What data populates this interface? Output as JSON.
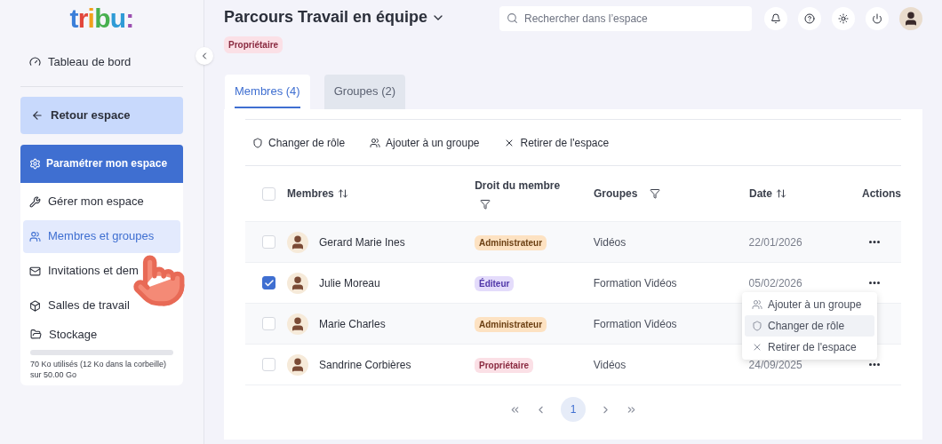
{
  "logo": "tribu:",
  "sidebar": {
    "dashboard": {
      "label": "Tableau de bord"
    },
    "back_button": {
      "label": "Retour espace"
    },
    "settings_button": {
      "label": "Paramétrer mon espace",
      "selected": true
    },
    "items": [
      {
        "kind": "wrench",
        "label": "Gérer mon espace",
        "selected": false
      },
      {
        "kind": "users",
        "label": "Membres et groupes",
        "selected": true
      },
      {
        "kind": "mail",
        "label": "Invitations et dem",
        "selected": false
      },
      {
        "kind": "box",
        "label": "Salles de travail",
        "selected": false
      }
    ],
    "storage": {
      "label": "Stockage",
      "level": 0,
      "usage": "70 Ko utilisés (12 Ko dans la corbeille) sur 50.00 Go"
    }
  },
  "header": {
    "title": "Parcours Travail en équipe",
    "role_badge": "Propriétaire",
    "search": {
      "placeholder": "Rechercher dans l’espace"
    }
  },
  "tabs": [
    {
      "label": "Membres (4)",
      "selected": true
    },
    {
      "label": "Groupes (2)",
      "selected": false
    }
  ],
  "toolbar": [
    {
      "kind": "shield",
      "label": "Changer de rôle"
    },
    {
      "kind": "users",
      "label": "Ajouter à un groupe"
    },
    {
      "kind": "x",
      "label": "Retirer de l'espace"
    }
  ],
  "table": {
    "columns": [
      {
        "label": "Membres",
        "kind": "sort"
      },
      {
        "label": "Droit du membre",
        "kind": "filter"
      },
      {
        "label": "Groupes",
        "kind": "filter"
      },
      {
        "label": "Date",
        "kind": "sort"
      },
      {
        "label": "Actions",
        "kind": "plain"
      }
    ],
    "header_checked": false,
    "rows": [
      {
        "name": "Gerard Marie Ines",
        "role": "Administrateur",
        "kind": "admin",
        "groups": "Vidéos",
        "date": "22/01/2026",
        "checked": false,
        "menu_open": false
      },
      {
        "name": "Julie Moreau",
        "role": "Éditeur",
        "kind": "editor",
        "groups": "Formation Vidéos",
        "date": "05/02/2026",
        "checked": true,
        "menu_open": true
      },
      {
        "name": "Marie Charles",
        "role": "Administrateur",
        "kind": "admin",
        "groups": "Formation Vidéos",
        "checked": false,
        "menu_open": false
      },
      {
        "name": "Sandrine Corbières",
        "role": "Propriétaire",
        "kind": "owner",
        "groups": "Vidéos",
        "date": "24/09/2025",
        "checked": false,
        "menu_open": false
      }
    ]
  },
  "row_menu": [
    {
      "kind": "users",
      "label": "Ajouter à un groupe",
      "highlighted": false
    },
    {
      "kind": "shield",
      "label": "Changer de rôle",
      "highlighted": true
    },
    {
      "kind": "x",
      "label": "Retirer de l'espace",
      "highlighted": false
    }
  ],
  "pagination": {
    "pages": [
      {
        "label": "1",
        "selected": true
      }
    ]
  }
}
